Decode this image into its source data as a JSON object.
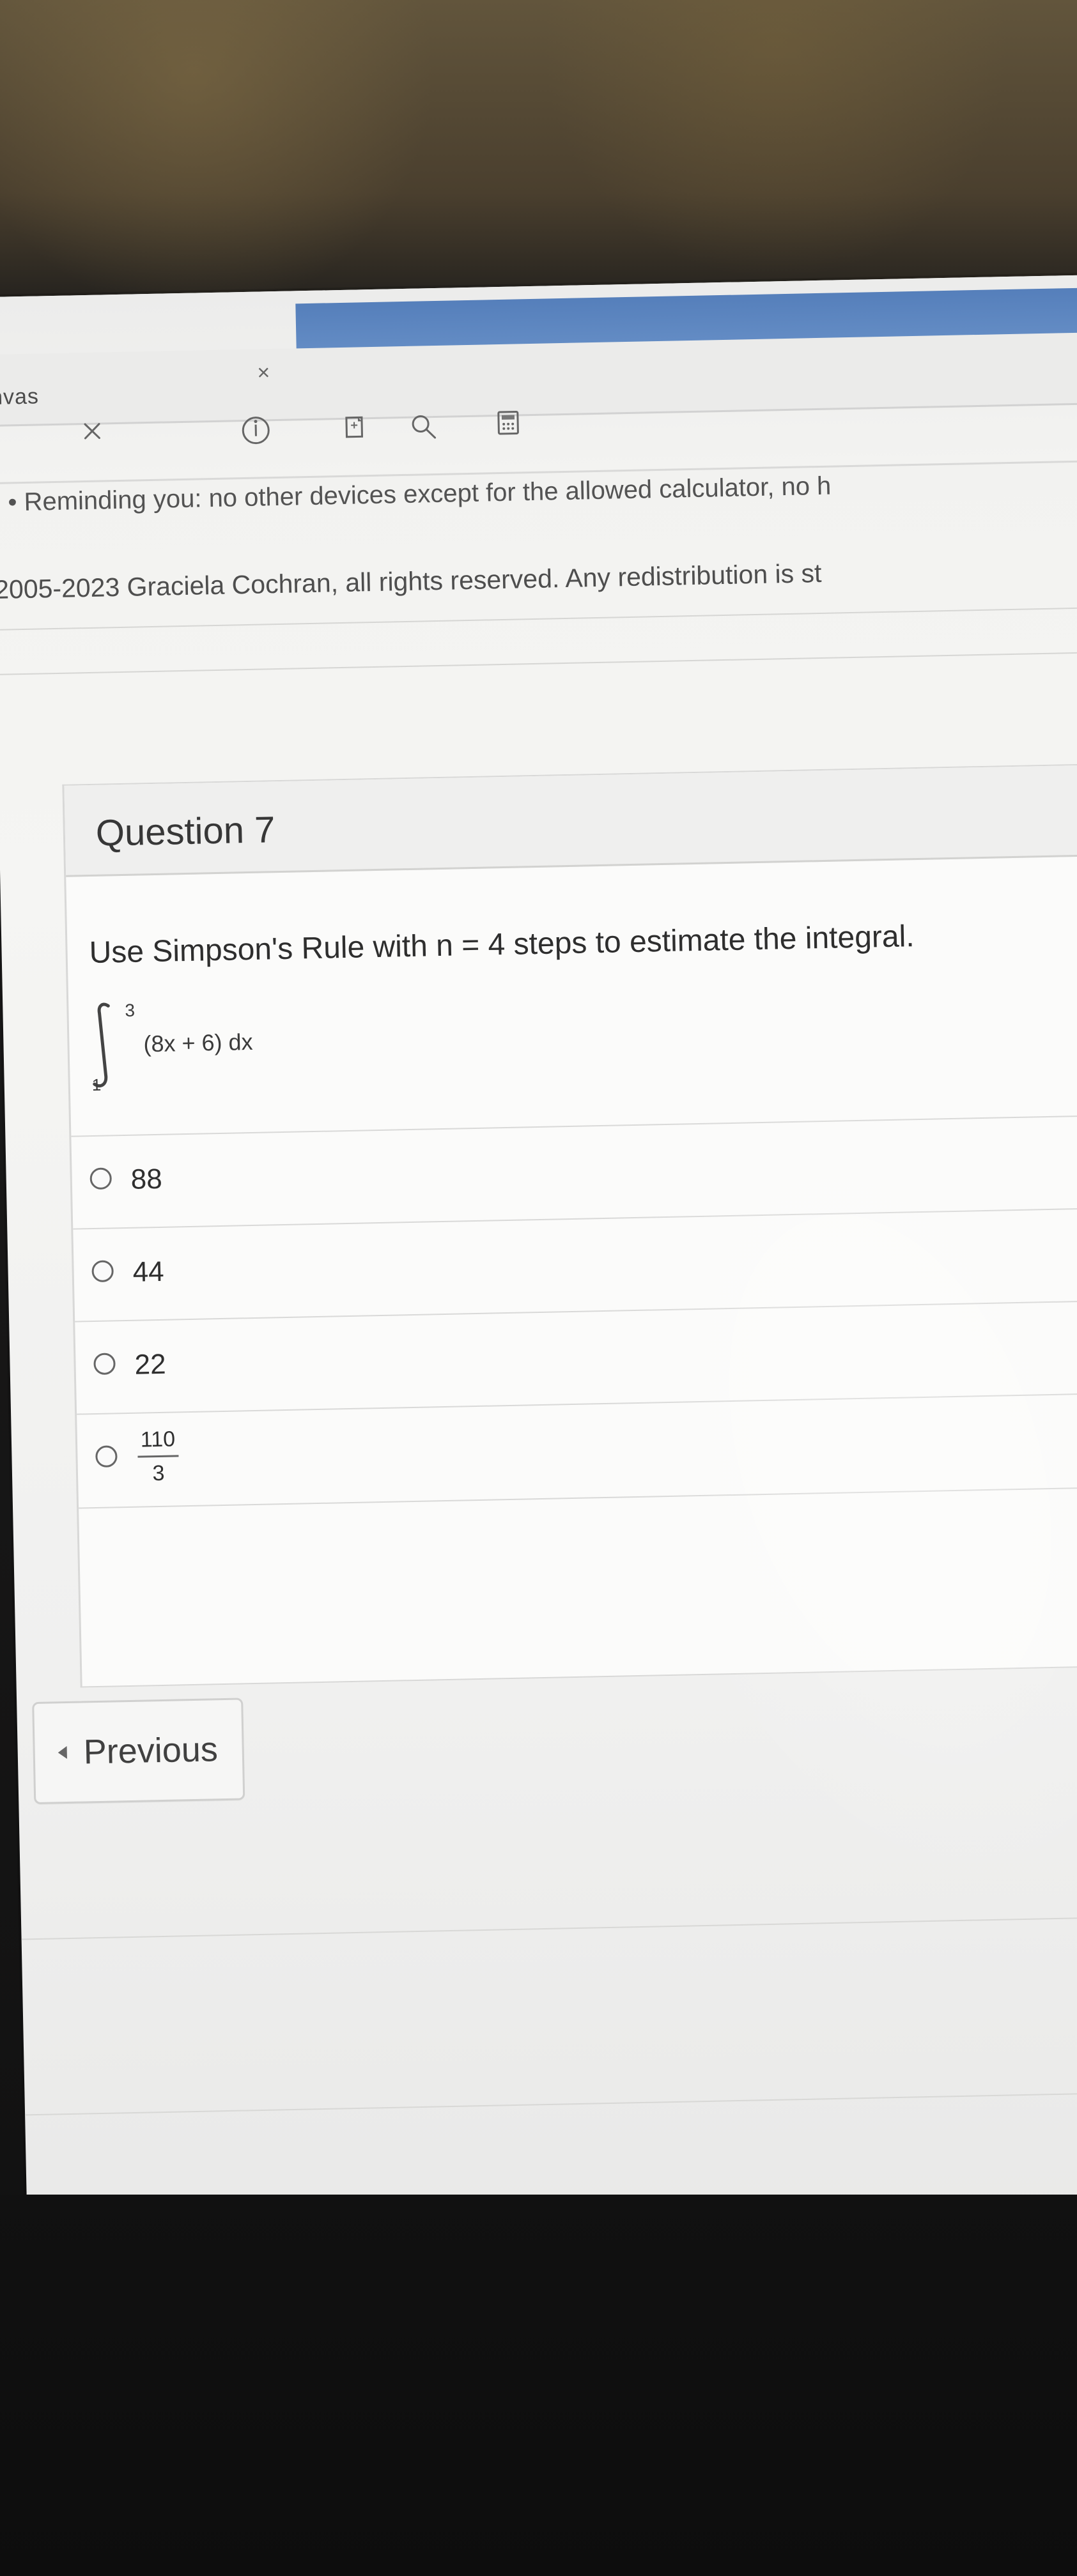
{
  "browser": {
    "tab_label": "nvas",
    "close_tab_symbol": "×",
    "close_icon_symbol": "✕",
    "toolbar_icons": [
      "info-icon",
      "page-icon",
      "search-icon",
      "calculator-icon"
    ]
  },
  "notice": {
    "reminder": "• Reminding you: no other devices except for the allowed calculator, no h",
    "copyright": "2005-2023 Graciela Cochran, all rights reserved. Any redistribution is st"
  },
  "question": {
    "title": "Question 7",
    "prompt": "Use Simpson's Rule with n = 4 steps to estimate the integral.",
    "integral": {
      "upper": "3",
      "lower": "1",
      "integrand": "(8x + 6) dx"
    },
    "answers": [
      {
        "text": "88"
      },
      {
        "text": "44"
      },
      {
        "text": "22"
      },
      {
        "numerator": "110",
        "denominator": "3"
      }
    ]
  },
  "navigation": {
    "previous_label": "Previous"
  }
}
